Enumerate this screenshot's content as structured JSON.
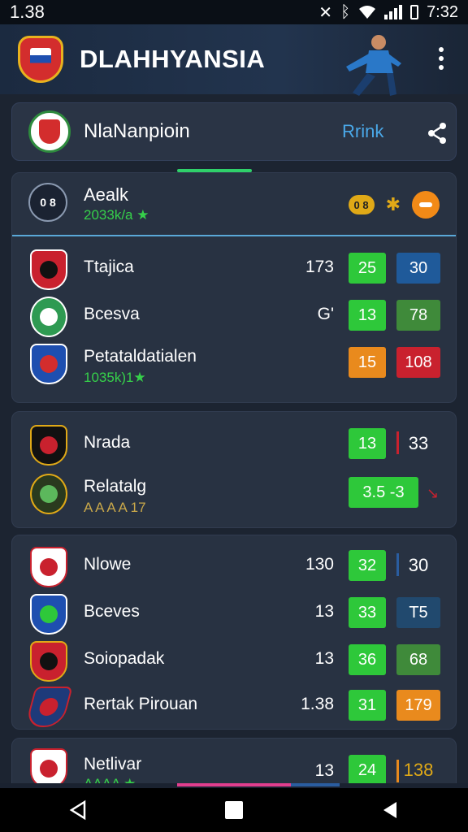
{
  "status": {
    "left": "1.38",
    "time": "7:32"
  },
  "app": {
    "title": "DLAHHYANSIA"
  },
  "league": {
    "name": "NlaNanpioin",
    "rank_label": "Rrink"
  },
  "section1": {
    "badge_text": "0 8",
    "title": "Aealk",
    "subtitle": "2033k/a ★",
    "pill_text": "0 8",
    "rows": [
      {
        "team": "Ttajica",
        "sub": "",
        "num": "173",
        "v1": "25",
        "v2": "30",
        "c1": "green",
        "c2": "blue"
      },
      {
        "team": "Bcesva",
        "sub": "",
        "num": "G'",
        "v1": "13",
        "v2": "78",
        "c1": "green",
        "c2": "olive"
      },
      {
        "team": "Petataldatialen",
        "sub": "1035k)1★",
        "num": "",
        "v1": "15",
        "v2": "108",
        "c1": "orange",
        "c2": "red"
      }
    ]
  },
  "section2": {
    "rows": [
      {
        "team": "Nrada",
        "sub": "",
        "num": "",
        "v1": "13",
        "v2": "33"
      },
      {
        "team": "Relatalg",
        "sub": "A A A A 17",
        "num": "",
        "v1": "3.5 -3",
        "v2": ""
      }
    ]
  },
  "section3": {
    "rows": [
      {
        "team": "Nlowe",
        "num": "130",
        "v1": "32",
        "v2": "30",
        "c2": "plain"
      },
      {
        "team": "Bceves",
        "num": "13",
        "v1": "33",
        "v2": "T5",
        "c2": "navy"
      },
      {
        "team": "Soiopadak",
        "num": "13",
        "v1": "36",
        "v2": "68",
        "c2": "olive"
      },
      {
        "team": "Rertak Pirouan",
        "num": "1.38",
        "v1": "31",
        "v2": "179",
        "c2": "orange"
      }
    ]
  },
  "section4": {
    "rows": [
      {
        "team": "Netlivar",
        "sub": "AAAA ★",
        "num": "13",
        "v1": "24",
        "v2": "138"
      }
    ]
  },
  "colors": {
    "accent_green": "#2ec83a",
    "accent_blue": "#4aa8e8",
    "background": "#1c2431",
    "card": "#283242"
  },
  "icons": [
    "wifi-icon",
    "signal-icon",
    "battery-icon",
    "share-icon",
    "menu-icon",
    "back-icon",
    "home-icon",
    "recents-icon"
  ]
}
